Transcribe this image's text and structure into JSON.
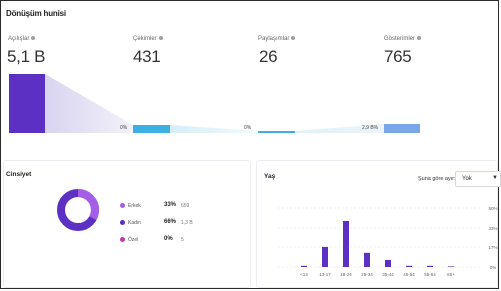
{
  "funnel": {
    "title": "Dönüşüm hunisi",
    "metrics": [
      {
        "label": "Açılışlar",
        "value": "5,1 B"
      },
      {
        "label": "Çekimler",
        "value": "431"
      },
      {
        "label": "Paylaşımlar",
        "value": "26"
      },
      {
        "label": "Gösterimler",
        "value": "765"
      }
    ],
    "conversions": [
      "0%",
      "0%",
      "2,9 B%"
    ]
  },
  "gender": {
    "title": "Cinsiyet",
    "items": [
      {
        "label": "Erkek",
        "pct": "33%",
        "count": "659",
        "color": "#a55ee8"
      },
      {
        "label": "Kadın",
        "pct": "66%",
        "count": "1,3 B",
        "color": "#5b30c2"
      },
      {
        "label": "Özel",
        "pct": "0%",
        "count": "5",
        "color": "#c43aa0"
      }
    ]
  },
  "age": {
    "title": "Yaş",
    "breakdown_label": "Şuna göre ayır:",
    "breakdown_value": "Yok",
    "y_ticks": [
      "50%",
      "33%",
      "17%",
      "0%"
    ]
  },
  "chart_data": {
    "type": "bar",
    "categories": [
      "<13",
      "13-17",
      "18-24",
      "25-34",
      "35-44",
      "45-54",
      "55-64",
      "65+"
    ],
    "values": [
      1,
      17,
      39,
      12,
      6,
      1,
      1,
      0.5
    ],
    "ylim": [
      0,
      50
    ],
    "color": "#5b30c2"
  }
}
